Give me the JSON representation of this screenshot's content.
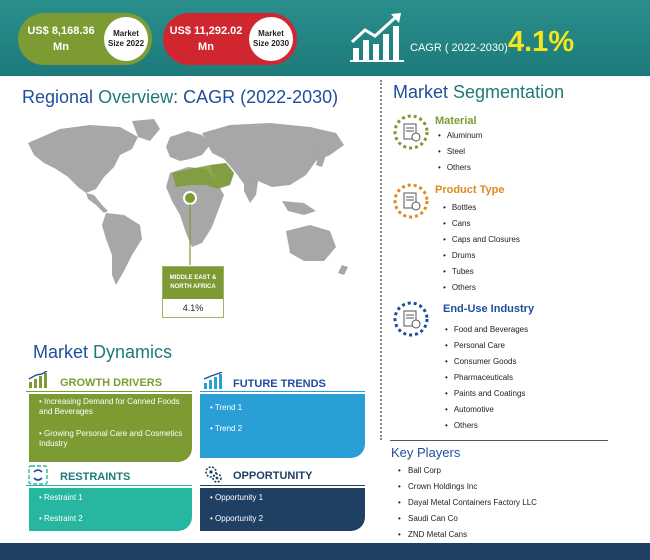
{
  "header": {
    "value_2022": "US$ 8,168.36 Mn",
    "label_2022": "Market Size 2022",
    "value_2030": "US$ 11,292.02 Mn",
    "label_2030": "Market Size 2030",
    "cagr_label": "CAGR ( 2022-2030)",
    "cagr_value": "4.1%"
  },
  "regional": {
    "title_a": "Regional ",
    "title_b": "Overview",
    "title_c": ": CAGR (2022-2030)",
    "region_name": "MIDDLE EAST & NORTH AFRICA",
    "region_value": "4.1%"
  },
  "segmentation": {
    "title_a": "Market ",
    "title_b": "Segmentation",
    "groups": [
      {
        "name": "Material",
        "color": "#7d9b33",
        "items": [
          "Aluminum",
          "Steel",
          "Others"
        ]
      },
      {
        "name": "Product Type",
        "color": "#e08a1e",
        "items": [
          "Bottles",
          "Cans",
          "Caps and Closures",
          "Drums",
          "Tubes",
          "Others"
        ]
      },
      {
        "name": "End-Use Industry",
        "color": "#1f4e9c",
        "items": [
          "Food and Beverages",
          "Personal Care",
          "Consumer Goods",
          "Pharmaceuticals",
          "Paints and Coatings",
          "Automotive",
          "Others"
        ]
      }
    ]
  },
  "dynamics": {
    "title_a": "Market ",
    "title_b": "Dynamics",
    "drivers": {
      "title": "GROWTH DRIVERS",
      "items": [
        "Increasing Demand for Canned Foods and Beverages",
        "Growing Personal Care and Cosmetics Industry"
      ]
    },
    "trends": {
      "title": "FUTURE TRENDS",
      "items": [
        "Trend 1",
        "Trend 2"
      ]
    },
    "restraints": {
      "title": "RESTRAINTS",
      "items": [
        "Restraint 1",
        "Restraint 2"
      ]
    },
    "opportunity": {
      "title": "OPPORTUNITY",
      "items": [
        "Opportunity 1",
        "Opportunity 2"
      ]
    }
  },
  "key_players": {
    "title": "Key Players",
    "items": [
      "Ball Corp",
      "Crown Holdings Inc",
      "Dayal Metal Containers Factory LLC",
      "Saudi Can Co",
      "ZND Metal Cans"
    ]
  },
  "colors": {
    "teal": "#1d7a7a",
    "olive": "#7d9b33",
    "red": "#d0262f",
    "blue": "#1f4e9c",
    "sky": "#2a9fd6",
    "sea": "#27b7a0",
    "navy": "#1f3f63",
    "yellow": "#f5e61a",
    "orange": "#e08a1e"
  }
}
